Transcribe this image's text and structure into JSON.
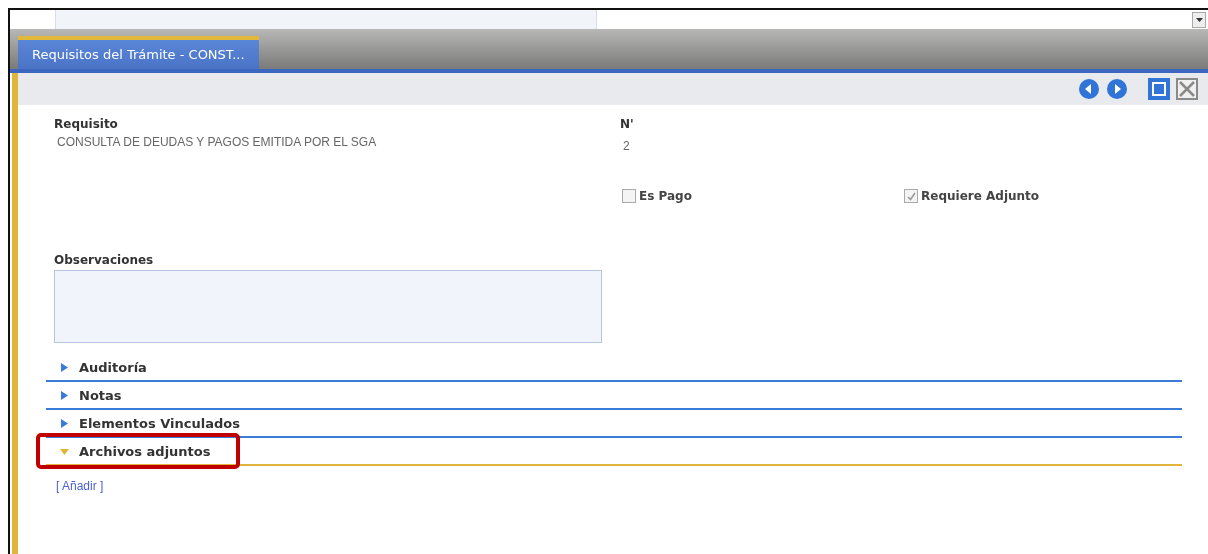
{
  "tabs": [
    {
      "label": "Requisitos del Trámite - CONST...",
      "selected": true
    }
  ],
  "fields": {
    "requisito": {
      "label": "Requisito",
      "value": "CONSULTA DE DEUDAS Y PAGOS EMITIDA POR EL SGA"
    },
    "numero": {
      "label": "N'",
      "value": "2"
    }
  },
  "checkboxes": [
    {
      "label": "Es Pago",
      "checked": false
    },
    {
      "label": "Requiere Adjunto",
      "checked": true
    }
  ],
  "observaciones": {
    "label": "Observaciones"
  },
  "sections": [
    {
      "title": "Auditoría",
      "expanded": false,
      "highlighted": false
    },
    {
      "title": "Notas",
      "expanded": false,
      "highlighted": false
    },
    {
      "title": "Elementos Vinculados",
      "expanded": false,
      "highlighted": false
    },
    {
      "title": "Archivos adjuntos",
      "expanded": true,
      "highlighted": true
    }
  ],
  "add_link": "[ Añadir ]"
}
